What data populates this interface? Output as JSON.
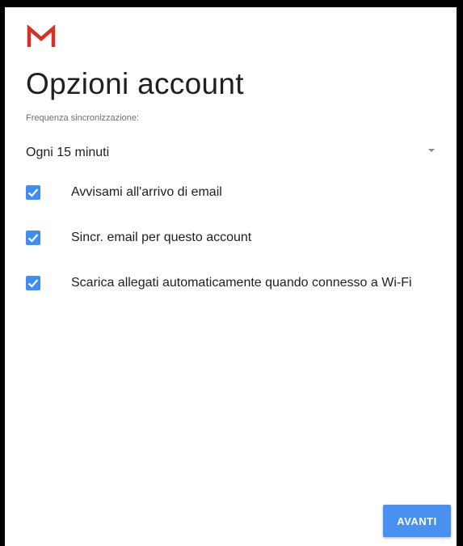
{
  "header": {
    "title": "Opzioni account",
    "logo_icon": "gmail-m-icon",
    "brand_color": "#d93025"
  },
  "sync": {
    "label": "Frequenza sincronizzazione:",
    "selected": "Ogni 15 minuti"
  },
  "options": [
    {
      "label": "Avvisami all'arrivo di email",
      "checked": true
    },
    {
      "label": "Sincr. email per questo account",
      "checked": true
    },
    {
      "label": "Scarica allegati automaticamente quando connesso a Wi-Fi",
      "checked": true
    }
  ],
  "actions": {
    "next_label": "AVANTI"
  },
  "colors": {
    "accent": "#4a90f0",
    "checkbox": "#3f8cf4"
  }
}
